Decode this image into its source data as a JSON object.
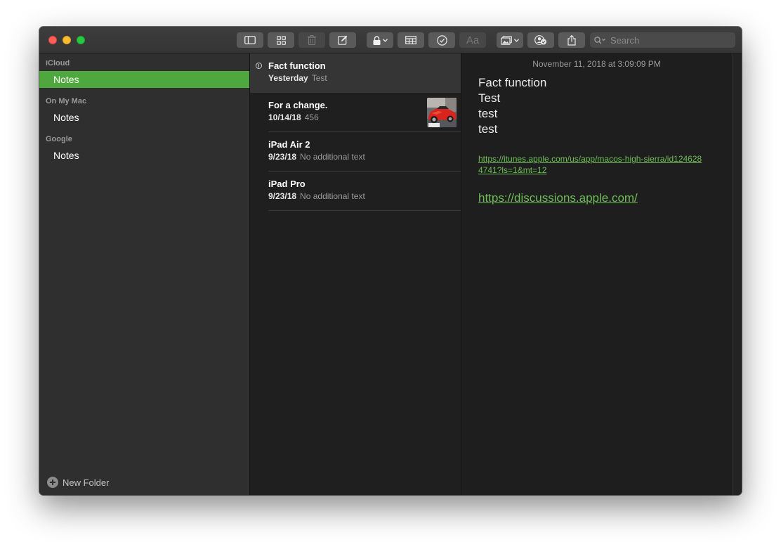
{
  "toolbar": {
    "search_placeholder": "Search",
    "format_label": "Aa"
  },
  "sidebar": {
    "sections": [
      {
        "title": "iCloud",
        "folder": "Notes"
      },
      {
        "title": "On My Mac",
        "folder": "Notes"
      },
      {
        "title": "Google",
        "folder": "Notes"
      }
    ],
    "new_folder_label": "New Folder",
    "accent_color": "#4fa83d"
  },
  "notes": [
    {
      "title": "Fact function",
      "date": "Yesterday",
      "preview": "Test",
      "pinned_icon": true
    },
    {
      "title": "For a change.",
      "date": "10/14/18",
      "preview": "456",
      "thumbnail": "red-sports-car"
    },
    {
      "title": "iPad Air 2",
      "date": "9/23/18",
      "preview": "No additional text"
    },
    {
      "title": "iPad Pro",
      "date": "9/23/18",
      "preview": "No additional text"
    }
  ],
  "editor": {
    "date": "November 11, 2018 at 3:09:09 PM",
    "lines": [
      "Fact function",
      "Test",
      "test",
      "test"
    ],
    "link1": "https://itunes.apple.com/us/app/macos-high-sierra/id1246284741?ls=1&mt=12",
    "link2": "https://discussions.apple.com/",
    "link_color": "#6fbd57"
  }
}
